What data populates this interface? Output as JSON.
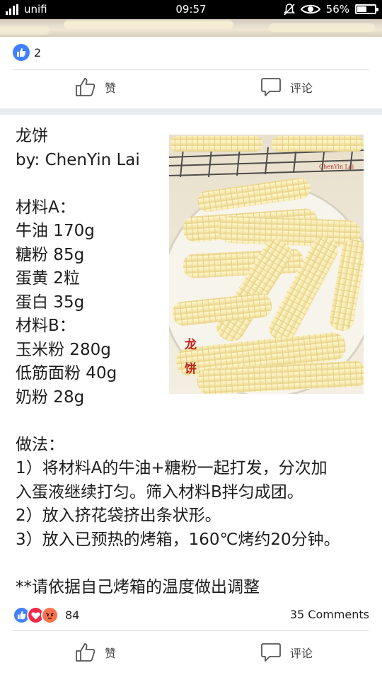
{
  "status_bar": {
    "carrier": "unifi",
    "time": "09:57",
    "battery": "56%",
    "battery_level": 0.56
  },
  "top_post": {
    "like_count": "2",
    "actions": {
      "like": "赞",
      "comment": "评论"
    }
  },
  "post": {
    "lines": [
      "龙饼",
      "by: ChenYin Lai",
      "",
      "材料A：",
      "牛油 170g",
      "糖粉 85g",
      "蛋黄 2粒",
      "蛋白 35g",
      "材料B：",
      "玉米粉 280g",
      "低筋面粉 40g",
      "奶粉 28g",
      "",
      "做法：",
      "1）将材料A的牛油+糖粉一起打发，分次加",
      "入蛋液继续打匀。筛入材料B拌匀成团。",
      "2）放入挤花袋挤出条状形。",
      "3）放入已预热的烤箱，160℃烤约20分钟。",
      "",
      "**请依据自己烤箱的温度做出调整"
    ],
    "photo": {
      "watermark": "ChenYin Lai",
      "stamp": "龙饼"
    }
  },
  "footer": {
    "reaction_count": "84",
    "comments": "35 Comments",
    "actions": {
      "like": "赞",
      "comment": "评论"
    },
    "colors": {
      "like": "#4080ff",
      "love": "#f0284a",
      "angry": "#f7714c"
    }
  }
}
